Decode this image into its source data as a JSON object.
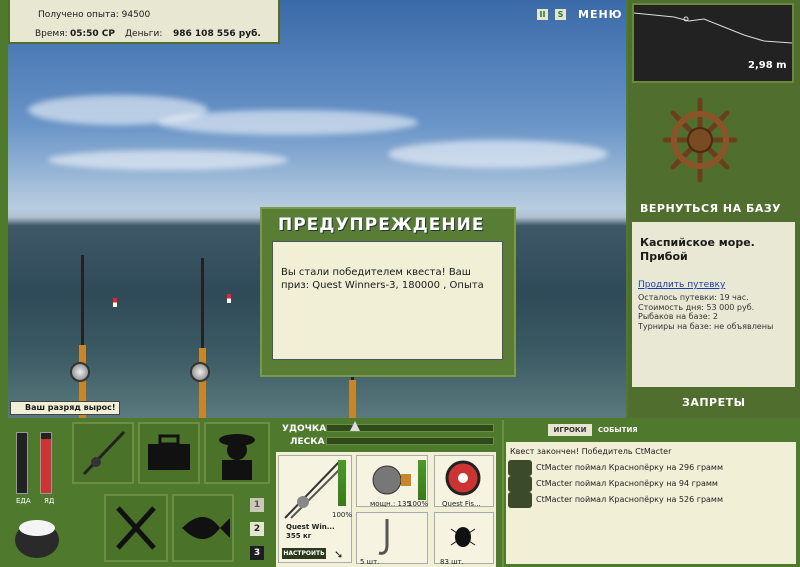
{
  "top_info": {
    "exp_label": "Получено опыта:",
    "exp_value": "94500",
    "time_label": "Время:",
    "time_value": "05:50 СР",
    "money_label": "Деньги:",
    "money_value": "986 108 556 руб."
  },
  "top_buttons": {
    "pause": "II",
    "sound": "S",
    "menu": "МЕНЮ"
  },
  "depth": {
    "value": "2,98 m"
  },
  "right_panel": {
    "return_label": "ВЕРНУТЬСЯ НА БАЗУ",
    "location_title": "Каспийское море. Прибой",
    "extend_link": "Продлить путевку",
    "lines": [
      "Осталось путевки: 19 час.",
      "Стоимость дня: 53 000 руб.",
      "Рыбаков на базе: 2",
      "Турниры на базе: не объявлены"
    ],
    "bans_label": "ЗАПРЕТЫ"
  },
  "dialog": {
    "title": "ПРЕДУПРЕЖДЕНИЕ",
    "text": "Вы стали победителем квеста! Ваш приз: Quest Winners-3, 180000 , Опыта"
  },
  "rank_notice": "Ваш разряд вырос!",
  "meters": {
    "food_label": "ЕДА",
    "poison_label": "ЯД"
  },
  "num_buttons": [
    "1",
    "2",
    "3"
  ],
  "rod_line": {
    "rod_label": "УДОЧКА",
    "line_label": "ЛЕСКА"
  },
  "tackle": {
    "rod_name": "Quest Win...",
    "rod_weight": "355 кг",
    "rod_percent": "100%",
    "reel_power": "мощн.: 135",
    "reel_percent": "100%",
    "line_name": "Quest Fis...",
    "hook_count": "5 шт.",
    "bait_count": "83 шт.",
    "setup_label": "НАСТРОИТЬ"
  },
  "events": {
    "tab_players": "ИГРОКИ",
    "tab_events": "СОБЫТИЯ",
    "rows": [
      "Квест закончен! Победитель CtMacter",
      "CtMacter поймал Краснопёрку на 296 грамм",
      "CtMacter поймал Краснопёрку на 94 грамм",
      "CtMacter поймал Краснопёрку на 526 грамм"
    ]
  },
  "colors": {
    "panel_green": "#4f7a2d",
    "cream": "#f1efd6",
    "accent_link": "#1a3ea8"
  }
}
